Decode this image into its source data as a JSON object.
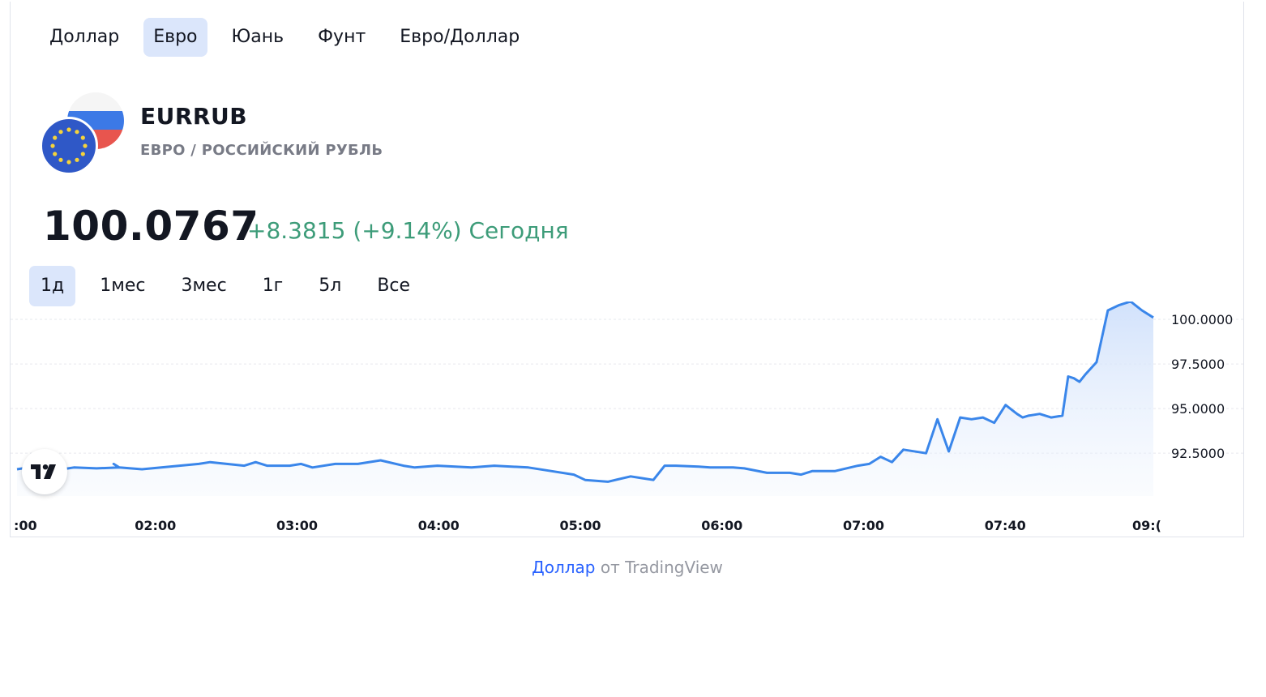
{
  "tabs": [
    {
      "label": "Доллар",
      "active": false
    },
    {
      "label": "Евро",
      "active": true
    },
    {
      "label": "Юань",
      "active": false
    },
    {
      "label": "Фунт",
      "active": false
    },
    {
      "label": "Евро/Доллар",
      "active": false
    }
  ],
  "symbol": {
    "ticker": "EURRUB",
    "description": "ЕВРО / РОССИЙСКИЙ РУБЛЬ",
    "base_flag_icon": "eu-flag-icon",
    "quote_flag_icon": "ru-flag-icon"
  },
  "quote": {
    "price": "100.0767",
    "change": "+8.3815 (+9.14%) Сегодня"
  },
  "ranges": [
    {
      "label": "1д",
      "active": true
    },
    {
      "label": "1мес",
      "active": false
    },
    {
      "label": "3мес",
      "active": false
    },
    {
      "label": "1г",
      "active": false
    },
    {
      "label": "5л",
      "active": false
    },
    {
      "label": "Все",
      "active": false
    }
  ],
  "attribution": {
    "link": "Доллар",
    "text": " от TradingView"
  },
  "colors": {
    "line": "#3a86ea",
    "positive": "#3d9c79",
    "accent": "#2962ff",
    "active_tab_bg": "#dbe6fb"
  },
  "chart_data": {
    "type": "area",
    "y_tick_labels": [
      "100.0000",
      "97.5000",
      "95.0000",
      "92.5000"
    ],
    "y_ticks": [
      100,
      97.5,
      95,
      92.5
    ],
    "ylim": [
      90.1,
      101.0
    ],
    "grid": true,
    "x_tick_labels": [
      ":00",
      "02:00",
      "03:00",
      "04:00",
      "05:00",
      "06:00",
      "07:00",
      "07:40",
      "09:("
    ],
    "x": [
      0,
      0.02,
      0.04,
      0.05,
      0.07,
      0.09,
      0.085,
      0.09,
      0.11,
      0.16,
      0.17,
      0.2,
      0.21,
      0.22,
      0.24,
      0.25,
      0.26,
      0.28,
      0.3,
      0.32,
      0.34,
      0.35,
      0.37,
      0.4,
      0.42,
      0.45,
      0.47,
      0.49,
      0.5,
      0.52,
      0.54,
      0.55,
      0.56,
      0.57,
      0.58,
      0.6,
      0.61,
      0.62,
      0.63,
      0.64,
      0.66,
      0.68,
      0.69,
      0.7,
      0.72,
      0.74,
      0.75,
      0.76,
      0.77,
      0.78,
      0.8,
      0.81,
      0.82,
      0.83,
      0.84,
      0.85,
      0.86,
      0.87,
      0.88,
      0.885,
      0.89,
      0.9,
      0.91,
      0.92,
      0.925,
      0.93,
      0.935,
      0.94,
      0.95,
      0.96,
      0.97,
      0.98,
      0.99,
      1.0
    ],
    "values": [
      91.6,
      91.8,
      91.6,
      91.7,
      91.65,
      91.7,
      91.9,
      91.7,
      91.6,
      91.9,
      92.0,
      91.8,
      92.0,
      91.8,
      91.8,
      91.9,
      91.7,
      91.9,
      91.9,
      92.1,
      91.8,
      91.7,
      91.8,
      91.7,
      91.8,
      91.7,
      91.5,
      91.3,
      91.0,
      90.9,
      91.2,
      91.1,
      91.0,
      91.8,
      91.8,
      91.75,
      91.7,
      91.7,
      91.7,
      91.65,
      91.4,
      91.4,
      91.3,
      91.5,
      91.5,
      91.8,
      91.9,
      92.3,
      92.0,
      92.7,
      92.5,
      94.4,
      92.6,
      94.5,
      94.4,
      94.5,
      94.2,
      95.2,
      94.7,
      94.5,
      94.6,
      94.7,
      94.5,
      94.6,
      96.8,
      96.7,
      96.5,
      96.9,
      97.6,
      100.5,
      100.8,
      101.0,
      100.5,
      100.1
    ]
  }
}
